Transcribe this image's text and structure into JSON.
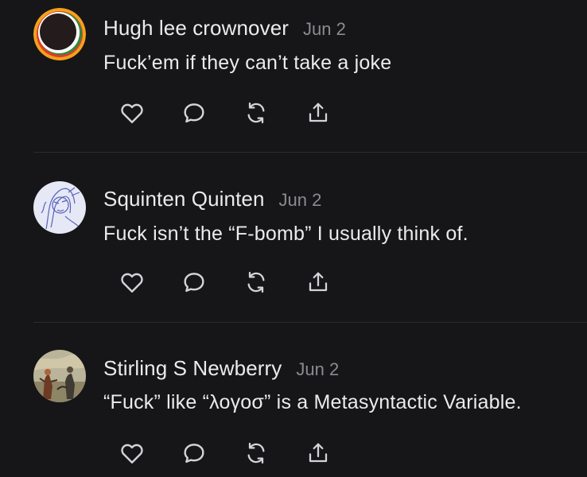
{
  "posts": [
    {
      "author": "Hugh lee crownover",
      "date": "Jun 2",
      "text": "Fuck’em if they can’t take a joke",
      "avatar_icon": "ringed-circle-avatar"
    },
    {
      "author": "Squinten Quinten",
      "date": "Jun 2",
      "text": "Fuck isn’t the “F-bomb” I usually think of.",
      "avatar_icon": "sketch-portrait-avatar"
    },
    {
      "author": "Stirling S Newberry",
      "date": "Jun 2",
      "text": "“Fuck” like “λογοσ” is a Metasyntactic Variable.",
      "avatar_icon": "painting-avatar"
    }
  ],
  "action_icons": [
    "heart-icon",
    "comment-icon",
    "repost-icon",
    "share-icon"
  ],
  "colors": {
    "background": "#161618",
    "text": "#ebebee",
    "muted": "#8b8b90",
    "icon": "#d4d4d8",
    "divider": "#2b2b2e"
  }
}
